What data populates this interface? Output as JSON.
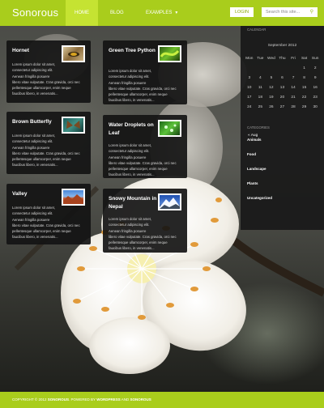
{
  "site": {
    "title": "Sonorous"
  },
  "nav": {
    "items": [
      {
        "label": "Home",
        "active": true
      },
      {
        "label": "Blog",
        "active": false
      },
      {
        "label": "Examples",
        "active": false,
        "has_dropdown": true
      }
    ]
  },
  "header": {
    "login_label": "LOGIN",
    "search_placeholder": "Search this site..."
  },
  "cards": [
    {
      "title": "Hornet",
      "thumb": "hornet-photo"
    },
    {
      "title": "Green Tree Python",
      "thumb": "python-photo"
    },
    {
      "title": "Brown Butterfly",
      "thumb": "butterfly-photo"
    },
    {
      "title": "Water Droplets on Leaf",
      "thumb": "leaf-photo"
    },
    {
      "title": "Valley",
      "thumb": "valley-photo"
    },
    {
      "title": "Snowy Mountain in Nepal",
      "thumb": "mountain-photo"
    }
  ],
  "excerpt_lines": [
    "Lorem ipsum dolor sit amet,",
    "consectetur adipiscing elit.",
    "Aenean fringilla posuere",
    "libero vitae vulputate. Cras gravida, orci nec",
    "pellentesque ullamcorper, enim neque",
    "faucibus libero, in venenatis..."
  ],
  "sidebar": {
    "calendar": {
      "title": "Calendar",
      "caption": "September 2012",
      "weekdays": [
        "Mon",
        "Tue",
        "Wed",
        "Thu",
        "Fri",
        "Sat",
        "Sun"
      ],
      "weeks": [
        [
          "",
          "",
          "",
          "",
          "",
          "1",
          "2"
        ],
        [
          "3",
          "4",
          "5",
          "6",
          "7",
          "8",
          "9"
        ],
        [
          "10",
          "11",
          "12",
          "13",
          "14",
          "15",
          "16"
        ],
        [
          "17",
          "18",
          "19",
          "20",
          "21",
          "22",
          "23"
        ],
        [
          "24",
          "25",
          "26",
          "27",
          "28",
          "29",
          "30"
        ]
      ],
      "prev_label": "« Aug"
    },
    "categories": {
      "title": "Categories",
      "items": [
        "Animals",
        "Food",
        "Landscape",
        "Plants",
        "Uncategorized"
      ]
    }
  },
  "footer": {
    "copyright": "Copyright © 2012 ",
    "site_name": "Sonorous",
    "powered_by": ". Powered by ",
    "platform": "WordPress",
    "and": " and ",
    "theme": "Sonorous"
  },
  "colors": {
    "accent": "#a9cd1c",
    "accent_active": "#c5e332",
    "card_bg": "#141414"
  }
}
